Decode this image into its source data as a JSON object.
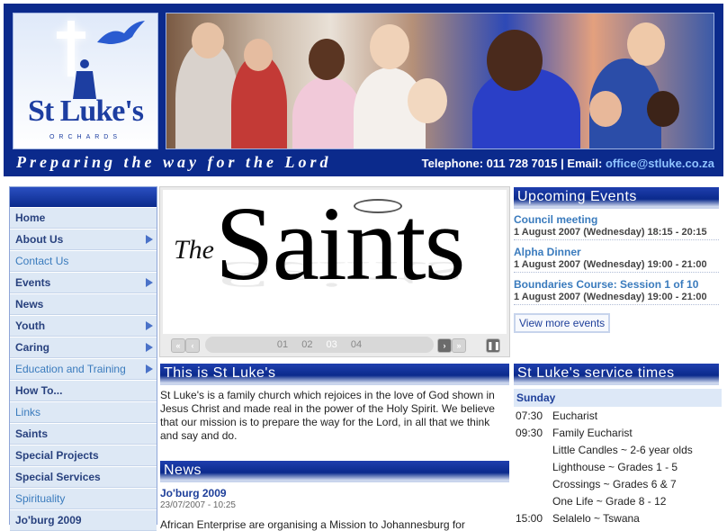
{
  "header": {
    "logo_name": "St Luke's",
    "logo_sub": "ORCHARDS",
    "tagline": "Preparing the way for the Lord",
    "telephone": "Telephone: 011 728 7015 | Email: ",
    "email": "office@stluke.co.za"
  },
  "nav": {
    "items": [
      {
        "label": "Home"
      },
      {
        "label": "About Us"
      },
      {
        "label": "Contact Us"
      },
      {
        "label": "Events"
      },
      {
        "label": "News"
      },
      {
        "label": "Youth"
      },
      {
        "label": "Caring"
      },
      {
        "label": "Education and Training"
      },
      {
        "label": "How To..."
      },
      {
        "label": "Links"
      },
      {
        "label": "Saints"
      },
      {
        "label": "Special Projects"
      },
      {
        "label": "Special Services"
      },
      {
        "label": "Spirituality"
      },
      {
        "label": "Jo'burg 2009"
      }
    ]
  },
  "banner": {
    "the": "The",
    "saints": "Saints",
    "pages": [
      "01",
      "02",
      "03",
      "04"
    ],
    "active_page": "03"
  },
  "about": {
    "heading": "This is St Luke's",
    "text": "St Luke's is a family church which rejoices in the love of God shown in Jesus Christ and made real in the power of the Holy Spirit. We believe that our mission is to prepare the way for the Lord, in all that we think and say and do."
  },
  "news": {
    "heading": "News",
    "title": "Jo'burg 2009",
    "date": "23/07/2007 - 10:25",
    "text": "African Enterprise are organising a Mission to Johannesburg for"
  },
  "events": {
    "heading": "Upcoming Events",
    "items": [
      {
        "title": "Council meeting",
        "date": "1 August 2007 (Wednesday) 18:15 - 20:15"
      },
      {
        "title": "Alpha Dinner",
        "date": "1 August 2007 (Wednesday) 19:00 - 21:00"
      },
      {
        "title": "Boundaries Course: Session 1 of 10",
        "date": "1 August 2007 (Wednesday) 19:00 - 21:00"
      }
    ],
    "more_label": "View more events"
  },
  "services": {
    "heading": "St Luke's service times",
    "day": "Sunday",
    "rows": [
      {
        "time": "07:30",
        "name": "Eucharist"
      },
      {
        "time": "09:30",
        "name": "Family Eucharist"
      },
      {
        "time": "",
        "name": "Little Candles ~ 2-6 year olds"
      },
      {
        "time": "",
        "name": "Lighthouse ~ Grades 1 - 5"
      },
      {
        "time": "",
        "name": "Crossings ~ Grades 6 & 7"
      },
      {
        "time": "",
        "name": "One Life ~ Grade 8 - 12"
      },
      {
        "time": "15:00",
        "name": "Selalelo ~ Tswana"
      }
    ]
  },
  "colors": {
    "header_blue": "#0b2a8c",
    "link_blue": "#3a7bbd",
    "nav_bg": "#dde8f5"
  }
}
